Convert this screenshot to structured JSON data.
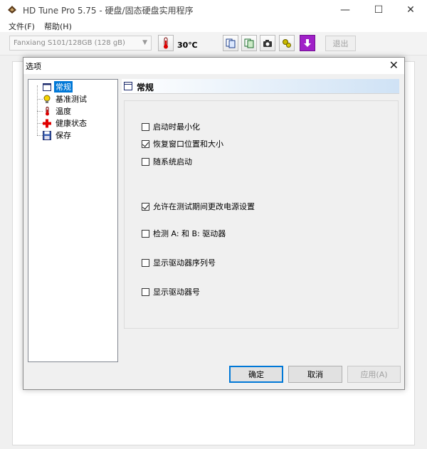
{
  "window": {
    "title": "HD Tune Pro 5.75 - 硬盘/固态硬盘实用程序",
    "minimize": "—",
    "maximize": "☐",
    "close": "✕"
  },
  "menu": {
    "file": "文件(F)",
    "help": "帮助(H)"
  },
  "toolbar": {
    "drive": "Fanxiang S101/128GB (128 gB)",
    "temperature": "30℃",
    "exit_label": "退出"
  },
  "dialog": {
    "title": "选项",
    "close": "✕",
    "tree": [
      {
        "label": "常规",
        "icon": "window-icon",
        "selected": true
      },
      {
        "label": "基准测试",
        "icon": "lightbulb-icon",
        "selected": false
      },
      {
        "label": "温度",
        "icon": "thermometer-icon",
        "selected": false
      },
      {
        "label": "健康状态",
        "icon": "red-cross-icon",
        "selected": false
      },
      {
        "label": "保存",
        "icon": "floppy-icon",
        "selected": false
      }
    ],
    "section_title": "常规",
    "options": [
      {
        "label": "启动时最小化",
        "checked": false
      },
      {
        "label": "恢复窗口位置和大小",
        "checked": true
      },
      {
        "label": "随系统启动",
        "checked": false
      },
      {
        "label": "允许在测试期间更改电源设置",
        "checked": true
      },
      {
        "label": "检测 A: 和 B: 驱动器",
        "checked": false
      },
      {
        "label": "显示驱动器序列号",
        "checked": false
      },
      {
        "label": "显示驱动器号",
        "checked": false
      }
    ],
    "ok_label": "确定",
    "cancel_label": "取消",
    "apply_label": "应用(A)"
  }
}
